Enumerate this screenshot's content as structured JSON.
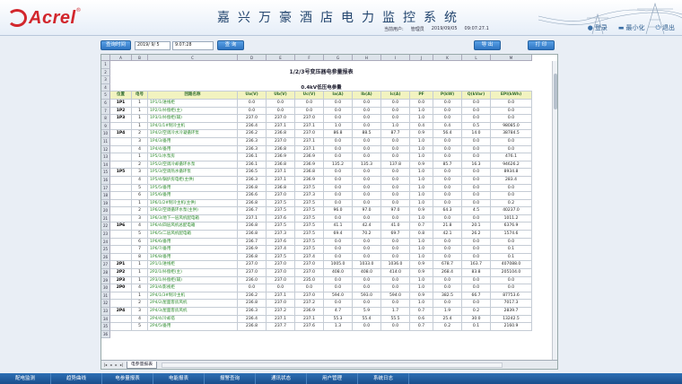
{
  "header": {
    "logo_text": "Acrel",
    "logo_reg": "®",
    "system_title": "嘉兴万豪酒店电力监控系统",
    "user_label": "当前用户:",
    "user_name": "管理员",
    "date": "2019/09/05",
    "time": "09:07:27.1",
    "actions": [
      {
        "label": "登录",
        "icon": "user-icon"
      },
      {
        "label": "最小化",
        "icon": "minimize-icon"
      },
      {
        "label": "退出",
        "icon": "exit-icon"
      }
    ]
  },
  "toolbar": {
    "report_select_label": "查询时间",
    "date_value": "2019/ 9/ 5",
    "time_value": "9:07:28",
    "query_label": "查 询",
    "export_label": "导 出",
    "print_label": "打 印"
  },
  "sheet": {
    "column_letters": [
      "A",
      "B",
      "C",
      "D",
      "E",
      "F",
      "G",
      "H",
      "I",
      "J",
      "K",
      "L",
      "M"
    ],
    "row_numbers": [
      "1",
      "2",
      "3",
      "4",
      "5",
      "6",
      "7",
      "8",
      "9",
      "10",
      "11",
      "12",
      "13",
      "14",
      "15",
      "16",
      "17",
      "18",
      "19",
      "20",
      "21",
      "22",
      "23",
      "24",
      "25",
      "26",
      "27",
      "28",
      "29",
      "30",
      "31",
      "32",
      "33",
      "34",
      "35",
      "36"
    ],
    "report_title": "1/2/3号变压器电参量报表",
    "section_title": "0.4kV低压电参量",
    "headers": [
      "位置",
      "电号",
      "回路名称",
      "Ua(V)",
      "Ub(V)",
      "Uc(V)",
      "Ia(A)",
      "Ib(A)",
      "Ic(A)",
      "PF",
      "P(kW)",
      "Q(kVar)",
      "EPI(kWh)"
    ],
    "rows": [
      {
        "pos": "1P1",
        "no": "1",
        "name": "1P1/1/进线柜",
        "ua": "0.0",
        "ub": "0.0",
        "uc": "0.0",
        "ia": "0.0",
        "ib": "0.0",
        "ic": "0.0",
        "pf": "0.0",
        "p": "0.0",
        "q": "0.0",
        "epi": "0.0"
      },
      {
        "pos": "1P2",
        "no": "1",
        "name": "1P2/1/补偿柜(主)",
        "ua": "0.0",
        "ub": "0.0",
        "uc": "0.0",
        "ia": "0.0",
        "ib": "0.0",
        "ic": "0.0",
        "pf": "1.0",
        "p": "0.0",
        "q": "0.0",
        "epi": "0.0"
      },
      {
        "pos": "1P3",
        "no": "1",
        "name": "1P3/1/补偿柜(辅)",
        "ua": "237.0",
        "ub": "237.0",
        "uc": "237.0",
        "ia": "0.0",
        "ib": "0.0",
        "ic": "0.0",
        "pf": "1.0",
        "p": "0.0",
        "q": "0.0",
        "epi": "0.0"
      },
      {
        "pos": "",
        "no": "1",
        "name": "1P4/1/1#制冷主机",
        "ua": "236.4",
        "ub": "237.1",
        "uc": "237.1",
        "ia": "1.0",
        "ib": "0.0",
        "ic": "1.0",
        "pf": "0.4",
        "p": "0.4",
        "q": "0.5",
        "epi": "98085.0"
      },
      {
        "pos": "1P4",
        "no": "2",
        "name": "1P4/2/空调冷水冷凝循环泵",
        "ua": "236.2",
        "ub": "236.8",
        "uc": "237.0",
        "ia": "86.8",
        "ib": "88.5",
        "ic": "87.7",
        "pf": "0.9",
        "p": "56.4",
        "q": "14.0",
        "epi": "38784.5"
      },
      {
        "pos": "",
        "no": "3",
        "name": "1P4/3/备用",
        "ua": "236.3",
        "ub": "237.0",
        "uc": "237.1",
        "ia": "0.0",
        "ib": "0.0",
        "ic": "0.0",
        "pf": "1.0",
        "p": "0.0",
        "q": "0.0",
        "epi": "0.0"
      },
      {
        "pos": "",
        "no": "4",
        "name": "1P4/4/备用",
        "ua": "236.3",
        "ub": "236.8",
        "uc": "237.1",
        "ia": "0.0",
        "ib": "0.0",
        "ic": "0.0",
        "pf": "1.0",
        "p": "0.0",
        "q": "0.0",
        "epi": "0.0"
      },
      {
        "pos": "",
        "no": "1",
        "name": "1P5/1/水泵房",
        "ua": "236.1",
        "ub": "236.9",
        "uc": "236.9",
        "ia": "0.0",
        "ib": "0.0",
        "ic": "0.0",
        "pf": "1.0",
        "p": "0.0",
        "q": "0.0",
        "epi": "476.1"
      },
      {
        "pos": "",
        "no": "2",
        "name": "1P5/2/空调冷却循环水泵",
        "ua": "236.1",
        "ub": "236.8",
        "uc": "236.9",
        "ia": "135.2",
        "ib": "135.3",
        "ic": "137.8",
        "pf": "0.9",
        "p": "85.7",
        "q": "16.3",
        "epi": "94626.2"
      },
      {
        "pos": "1P5",
        "no": "3",
        "name": "1P5/3/空调热水循环泵",
        "ua": "236.5",
        "ub": "237.1",
        "uc": "236.8",
        "ia": "0.0",
        "ib": "0.0",
        "ic": "0.0",
        "pf": "1.0",
        "p": "0.0",
        "q": "0.0",
        "epi": "8934.8"
      },
      {
        "pos": "",
        "no": "4",
        "name": "1P5/4/锅炉房电柜(主供)",
        "ua": "236.3",
        "ub": "237.1",
        "uc": "236.9",
        "ia": "0.0",
        "ib": "0.0",
        "ic": "0.0",
        "pf": "1.0",
        "p": "0.0",
        "q": "0.0",
        "epi": "283.4"
      },
      {
        "pos": "",
        "no": "5",
        "name": "1P5/5/备用",
        "ua": "236.8",
        "ub": "236.8",
        "uc": "237.5",
        "ia": "0.0",
        "ib": "0.0",
        "ic": "0.0",
        "pf": "1.0",
        "p": "0.0",
        "q": "0.0",
        "epi": "0.0"
      },
      {
        "pos": "",
        "no": "6",
        "name": "1P5/6/备用",
        "ua": "236.6",
        "ub": "237.0",
        "uc": "237.3",
        "ia": "0.0",
        "ib": "0.0",
        "ic": "0.0",
        "pf": "1.0",
        "p": "0.0",
        "q": "0.0",
        "epi": "0.0"
      },
      {
        "pos": "",
        "no": "1",
        "name": "1P6/1/2#制冷主机(主供)",
        "ua": "236.8",
        "ub": "237.5",
        "uc": "237.5",
        "ia": "0.0",
        "ib": "0.0",
        "ic": "0.0",
        "pf": "1.0",
        "p": "0.0",
        "q": "0.0",
        "epi": "0.2"
      },
      {
        "pos": "",
        "no": "2",
        "name": "1P6/2/空调循环水泵(主供)",
        "ua": "236.7",
        "ub": "237.5",
        "uc": "237.5",
        "ia": "96.0",
        "ib": "97.0",
        "ic": "97.0",
        "pf": "0.9",
        "p": "64.3",
        "q": "4.5",
        "epi": "40237.0"
      },
      {
        "pos": "",
        "no": "3",
        "name": "1P6/3/地下一层风机配电箱",
        "ua": "237.1",
        "ub": "237.6",
        "uc": "237.5",
        "ia": "0.0",
        "ib": "0.0",
        "ic": "0.0",
        "pf": "1.0",
        "p": "0.0",
        "q": "0.0",
        "epi": "1011.2"
      },
      {
        "pos": "1P6",
        "no": "4",
        "name": "1P6/4/四层风机总配电箱",
        "ua": "236.8",
        "ub": "237.5",
        "uc": "237.5",
        "ia": "41.1",
        "ib": "42.4",
        "ic": "41.0",
        "pf": "0.7",
        "p": "21.8",
        "q": "20.1",
        "epi": "6376.9"
      },
      {
        "pos": "",
        "no": "5",
        "name": "1P6/5/二层风机配电箱",
        "ua": "236.8",
        "ub": "237.3",
        "uc": "237.5",
        "ia": "69.4",
        "ib": "70.2",
        "ic": "69.7",
        "pf": "0.8",
        "p": "42.1",
        "q": "26.2",
        "epi": "1574.6"
      },
      {
        "pos": "",
        "no": "6",
        "name": "1P6/6/备用",
        "ua": "236.7",
        "ub": "237.6",
        "uc": "237.5",
        "ia": "0.0",
        "ib": "0.0",
        "ic": "0.0",
        "pf": "1.0",
        "p": "0.0",
        "q": "0.0",
        "epi": "0.0"
      },
      {
        "pos": "",
        "no": "7",
        "name": "1P6/7/备用",
        "ua": "236.9",
        "ub": "237.4",
        "uc": "237.5",
        "ia": "0.0",
        "ib": "0.0",
        "ic": "0.0",
        "pf": "1.0",
        "p": "0.0",
        "q": "0.0",
        "epi": "0.1"
      },
      {
        "pos": "",
        "no": "8",
        "name": "1P6/8/备用",
        "ua": "236.8",
        "ub": "237.5",
        "uc": "237.4",
        "ia": "0.0",
        "ib": "0.0",
        "ic": "0.0",
        "pf": "1.0",
        "p": "0.0",
        "q": "0.0",
        "epi": "0.1"
      },
      {
        "pos": "2P1",
        "no": "1",
        "name": "2P1/1/进线柜",
        "ua": "237.0",
        "ub": "237.0",
        "uc": "237.0",
        "ia": "1005.0",
        "ib": "1033.0",
        "ic": "1036.0",
        "pf": "0.9",
        "p": "678.7",
        "q": "163.7",
        "epi": "407088.0"
      },
      {
        "pos": "2P2",
        "no": "1",
        "name": "2P2/1/补偿柜(主)",
        "ua": "237.0",
        "ub": "237.0",
        "uc": "237.0",
        "ia": "408.0",
        "ib": "408.0",
        "ic": "414.0",
        "pf": "0.9",
        "p": "268.4",
        "q": "83.8",
        "epi": "205104.0"
      },
      {
        "pos": "2P3",
        "no": "1",
        "name": "2P3/1/补偿柜(辅)",
        "ua": "236.0",
        "ub": "237.0",
        "uc": "235.0",
        "ia": "0.0",
        "ib": "0.0",
        "ic": "0.0",
        "pf": "1.0",
        "p": "0.0",
        "q": "0.0",
        "epi": "0.0"
      },
      {
        "pos": "2P0",
        "no": "4",
        "name": "2P3/4/影视柜",
        "ua": "0.0",
        "ub": "0.0",
        "uc": "0.0",
        "ia": "0.0",
        "ib": "0.0",
        "ic": "0.0",
        "pf": "1.0",
        "p": "0.0",
        "q": "0.0",
        "epi": "0.0"
      },
      {
        "pos": "",
        "no": "1",
        "name": "2P4/1/3#制冷主机",
        "ua": "236.2",
        "ub": "237.1",
        "uc": "237.0",
        "ia": "594.0",
        "ib": "593.0",
        "ic": "594.0",
        "pf": "0.9",
        "p": "382.5",
        "q": "66.7",
        "epi": "87753.6"
      },
      {
        "pos": "",
        "no": "2",
        "name": "2P4/2/屋面客房风机",
        "ua": "236.8",
        "ub": "237.0",
        "uc": "237.2",
        "ia": "0.0",
        "ib": "0.0",
        "ic": "0.0",
        "pf": "1.0",
        "p": "0.0",
        "q": "0.0",
        "epi": "7017.3"
      },
      {
        "pos": "2P4",
        "no": "3",
        "name": "2P4/3/屋面客房风机",
        "ua": "236.3",
        "ub": "237.2",
        "uc": "236.9",
        "ia": "4.7",
        "ib": "5.9",
        "ic": "1.7",
        "pf": "0.7",
        "p": "1.9",
        "q": "0.2",
        "epi": "2839.7"
      },
      {
        "pos": "",
        "no": "4",
        "name": "2P4/4/冷却塔",
        "ua": "236.4",
        "ub": "237.1",
        "uc": "237.1",
        "ia": "55.3",
        "ib": "55.4",
        "ic": "55.5",
        "pf": "0.6",
        "p": "25.4",
        "q": "30.0",
        "epi": "13242.5"
      },
      {
        "pos": "",
        "no": "5",
        "name": "2P4/5/备用",
        "ua": "236.8",
        "ub": "237.7",
        "uc": "237.6",
        "ia": "1.3",
        "ib": "0.0",
        "ic": "0.0",
        "pf": "0.7",
        "p": "0.2",
        "q": "0.1",
        "epi": "2160.9"
      }
    ],
    "sheet_tab": "电参量报表",
    "nav_buttons": [
      "|◂",
      "◂",
      "▸",
      "▸|"
    ]
  },
  "bottom_nav": [
    "配电监测",
    "趋势曲线",
    "电参量报表",
    "电能报表",
    "报警查询",
    "通讯状态",
    "用户管理",
    "系统日志"
  ],
  "colors": {
    "brand_red": "#d2262c",
    "nav_blue": "#1f5a9a",
    "accent_blue": "#2e74c2",
    "name_green": "#2b8a2b",
    "header_yellow": "#f2f3c0"
  }
}
